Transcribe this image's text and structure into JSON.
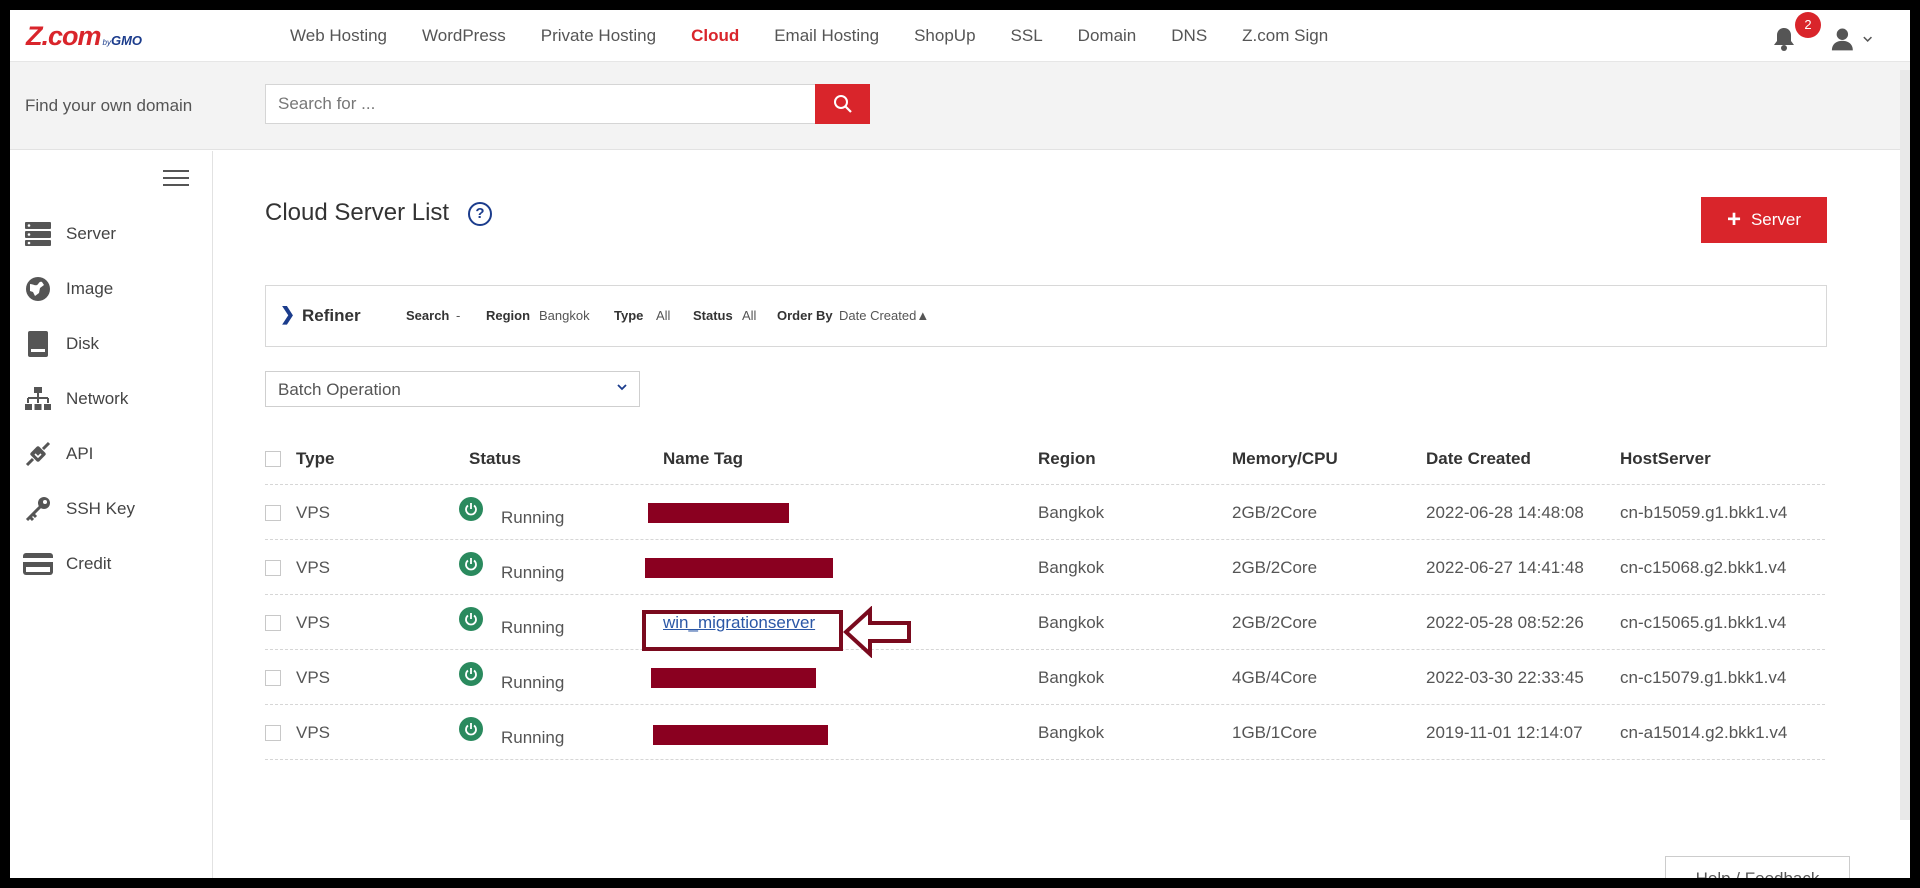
{
  "logo": {
    "main": "Z.com",
    "by": "by",
    "brand": "GMO"
  },
  "nav": {
    "items": [
      "Web Hosting",
      "WordPress",
      "Private Hosting",
      "Cloud",
      "Email Hosting",
      "ShopUp",
      "SSL",
      "Domain",
      "DNS",
      "Z.com Sign"
    ],
    "active": "Cloud",
    "notification_count": "2"
  },
  "search": {
    "label": "Find your own domain",
    "placeholder": "Search for ..."
  },
  "sidebar": {
    "items": [
      {
        "label": "Server",
        "icon": "server-icon"
      },
      {
        "label": "Image",
        "icon": "image-icon"
      },
      {
        "label": "Disk",
        "icon": "disk-icon"
      },
      {
        "label": "Network",
        "icon": "network-icon"
      },
      {
        "label": "API",
        "icon": "api-icon"
      },
      {
        "label": "SSH Key",
        "icon": "key-icon"
      },
      {
        "label": "Credit",
        "icon": "credit-card-icon"
      }
    ]
  },
  "main": {
    "title": "Cloud Server List",
    "help": "?",
    "add_button": "Server",
    "refiner": {
      "title": "Refiner",
      "search_k": "Search",
      "search_v": "-",
      "region_k": "Region",
      "region_v": "Bangkok",
      "type_k": "Type",
      "type_v": "All",
      "status_k": "Status",
      "status_v": "All",
      "order_k": "Order By",
      "order_v": "Date Created▲"
    },
    "batch": "Batch Operation",
    "table": {
      "headers": [
        "Type",
        "Status",
        "Name Tag",
        "Region",
        "Memory/CPU",
        "Date Created",
        "HostServer"
      ],
      "rows": [
        {
          "type": "VPS",
          "status": "Running",
          "name": "",
          "region": "Bangkok",
          "mem": "2GB/2Core",
          "date": "2022-06-28 14:48:08",
          "host": "cn-b15059.g1.bkk1.v4"
        },
        {
          "type": "VPS",
          "status": "Running",
          "name": "",
          "region": "Bangkok",
          "mem": "2GB/2Core",
          "date": "2022-06-27 14:41:48",
          "host": "cn-c15068.g2.bkk1.v4"
        },
        {
          "type": "VPS",
          "status": "Running",
          "name": "win_migrationserver",
          "region": "Bangkok",
          "mem": "2GB/2Core",
          "date": "2022-05-28 08:52:26",
          "host": "cn-c15065.g1.bkk1.v4"
        },
        {
          "type": "VPS",
          "status": "Running",
          "name": "",
          "region": "Bangkok",
          "mem": "4GB/4Core",
          "date": "2022-03-30 22:33:45",
          "host": "cn-c15079.g1.bkk1.v4"
        },
        {
          "type": "VPS",
          "status": "Running",
          "name": "",
          "region": "Bangkok",
          "mem": "1GB/1Core",
          "date": "2019-11-01 12:14:07",
          "host": "cn-a15014.g2.bkk1.v4"
        }
      ]
    },
    "help_feedback": "Help / Feedback"
  },
  "colors": {
    "brand_red": "#d9252b",
    "brand_blue": "#1b3c8c",
    "running_green": "#2a8a5e",
    "redaction": "#8a0020"
  }
}
